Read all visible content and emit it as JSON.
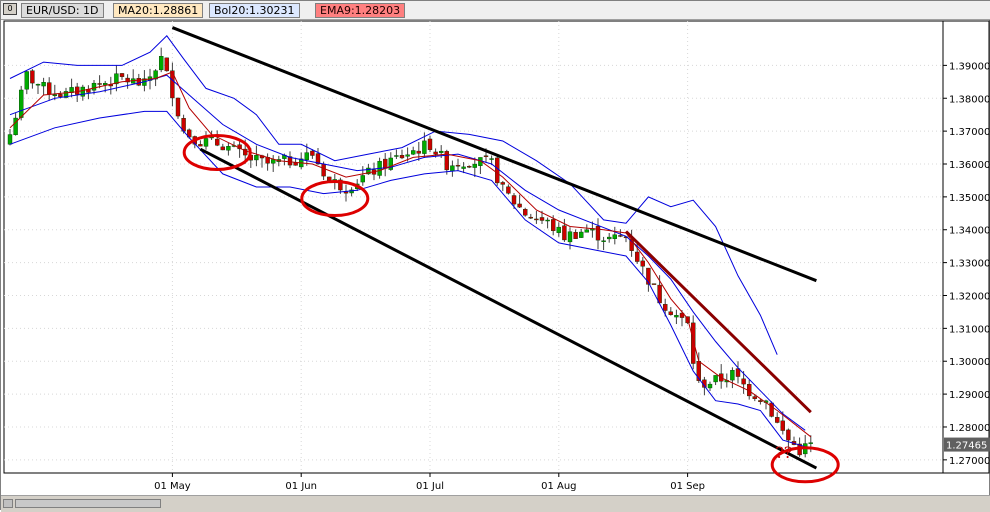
{
  "toolbar": {
    "symbol_tag": "EUR/USD: 1D",
    "ma_tag": "MA20:1.28861",
    "bol_tag": "Bol20:1.30231",
    "ema_tag": "EMA9:1.28203"
  },
  "annotation": {
    "question_marks": "??"
  },
  "colors": {
    "bull": "#00aa00",
    "bear": "#cc0000",
    "wick": "#404040",
    "bollinger": "#0000dd",
    "ma": "#b40000",
    "trendline": "#000000",
    "red_trendline": "#8b0000",
    "circle": "#dd0000",
    "grid": "#d8d8d8"
  },
  "chart_data": {
    "type": "candlestick",
    "title": "",
    "symbol": "EUR/USD",
    "timeframe": "1D",
    "indicators": {
      "MA20": 1.28861,
      "Bol20": 1.30231,
      "EMA9": 1.28203
    },
    "last_price": "1.27465",
    "ylim": [
      1.266,
      1.4035
    ],
    "y_ticks": [
      "1.39000",
      "1.38000",
      "1.37000",
      "1.36000",
      "1.35000",
      "1.34000",
      "1.33000",
      "1.32000",
      "1.31000",
      "1.30000",
      "1.29000",
      "1.28000",
      "1.27000"
    ],
    "x_ticks": [
      {
        "label": "01 May",
        "bar": 29
      },
      {
        "label": "01 Jun",
        "bar": 52
      },
      {
        "label": "01 Jul",
        "bar": 75
      },
      {
        "label": "01 Aug",
        "bar": 98
      },
      {
        "label": "01 Sep",
        "bar": 121
      }
    ],
    "bars": 144,
    "close_points": [
      [
        0,
        1.369
      ],
      [
        3,
        1.387
      ],
      [
        6,
        1.383
      ],
      [
        10,
        1.381
      ],
      [
        15,
        1.384
      ],
      [
        20,
        1.386
      ],
      [
        24,
        1.384
      ],
      [
        27,
        1.392
      ],
      [
        29,
        1.382
      ],
      [
        31,
        1.37
      ],
      [
        34,
        1.367
      ],
      [
        38,
        1.366
      ],
      [
        42,
        1.362
      ],
      [
        46,
        1.36
      ],
      [
        50,
        1.361
      ],
      [
        54,
        1.363
      ],
      [
        57,
        1.355
      ],
      [
        60,
        1.353
      ],
      [
        64,
        1.357
      ],
      [
        68,
        1.361
      ],
      [
        72,
        1.364
      ],
      [
        75,
        1.366
      ],
      [
        78,
        1.36
      ],
      [
        82,
        1.361
      ],
      [
        86,
        1.36
      ],
      [
        88,
        1.352
      ],
      [
        92,
        1.345
      ],
      [
        96,
        1.342
      ],
      [
        99,
        1.338
      ],
      [
        103,
        1.34
      ],
      [
        107,
        1.337
      ],
      [
        110,
        1.338
      ],
      [
        113,
        1.328
      ],
      [
        116,
        1.319
      ],
      [
        119,
        1.314
      ],
      [
        121,
        1.311
      ],
      [
        122,
        1.3
      ],
      [
        123,
        1.293
      ],
      [
        126,
        1.294
      ],
      [
        129,
        1.296
      ],
      [
        132,
        1.291
      ],
      [
        135,
        1.288
      ],
      [
        137,
        1.281
      ],
      [
        139,
        1.276
      ],
      [
        141,
        1.273
      ],
      [
        143,
        1.2746
      ]
    ],
    "bollinger_points": {
      "upper": [
        [
          0,
          1.386
        ],
        [
          6,
          1.391
        ],
        [
          12,
          1.39
        ],
        [
          20,
          1.39
        ],
        [
          25,
          1.394
        ],
        [
          28,
          1.399
        ],
        [
          31,
          1.392
        ],
        [
          35,
          1.383
        ],
        [
          40,
          1.38
        ],
        [
          44,
          1.375
        ],
        [
          48,
          1.366
        ],
        [
          52,
          1.366
        ],
        [
          58,
          1.361
        ],
        [
          64,
          1.363
        ],
        [
          70,
          1.365
        ],
        [
          76,
          1.37
        ],
        [
          82,
          1.369
        ],
        [
          88,
          1.367
        ],
        [
          94,
          1.361
        ],
        [
          100,
          1.354
        ],
        [
          106,
          1.343
        ],
        [
          110,
          1.342
        ],
        [
          114,
          1.35
        ],
        [
          118,
          1.347
        ],
        [
          122,
          1.349
        ],
        [
          126,
          1.341
        ],
        [
          130,
          1.326
        ],
        [
          134,
          1.314
        ],
        [
          137,
          1.302
        ]
      ],
      "middle": [
        [
          0,
          1.375
        ],
        [
          8,
          1.38
        ],
        [
          16,
          1.382
        ],
        [
          24,
          1.385
        ],
        [
          28,
          1.387
        ],
        [
          32,
          1.381
        ],
        [
          38,
          1.372
        ],
        [
          44,
          1.366
        ],
        [
          50,
          1.362
        ],
        [
          56,
          1.36
        ],
        [
          62,
          1.358
        ],
        [
          68,
          1.359
        ],
        [
          74,
          1.362
        ],
        [
          80,
          1.363
        ],
        [
          86,
          1.36
        ],
        [
          92,
          1.352
        ],
        [
          98,
          1.346
        ],
        [
          104,
          1.342
        ],
        [
          110,
          1.338
        ],
        [
          114,
          1.332
        ],
        [
          118,
          1.325
        ],
        [
          122,
          1.315
        ],
        [
          126,
          1.306
        ],
        [
          130,
          1.298
        ],
        [
          134,
          1.291
        ],
        [
          138,
          1.284
        ],
        [
          142,
          1.279
        ]
      ],
      "lower": [
        [
          0,
          1.366
        ],
        [
          8,
          1.371
        ],
        [
          16,
          1.374
        ],
        [
          24,
          1.376
        ],
        [
          28,
          1.376
        ],
        [
          32,
          1.368
        ],
        [
          38,
          1.357
        ],
        [
          44,
          1.353
        ],
        [
          50,
          1.353
        ],
        [
          56,
          1.351
        ],
        [
          62,
          1.352
        ],
        [
          68,
          1.355
        ],
        [
          74,
          1.357
        ],
        [
          80,
          1.358
        ],
        [
          86,
          1.355
        ],
        [
          92,
          1.343
        ],
        [
          98,
          1.336
        ],
        [
          104,
          1.334
        ],
        [
          110,
          1.332
        ],
        [
          114,
          1.324
        ],
        [
          118,
          1.311
        ],
        [
          122,
          1.297
        ],
        [
          126,
          1.288
        ],
        [
          130,
          1.287
        ],
        [
          134,
          1.285
        ],
        [
          138,
          1.276
        ],
        [
          142,
          1.274
        ]
      ]
    },
    "ma_points": [
      [
        0,
        1.371
      ],
      [
        6,
        1.381
      ],
      [
        12,
        1.382
      ],
      [
        20,
        1.385
      ],
      [
        26,
        1.386
      ],
      [
        29,
        1.388
      ],
      [
        32,
        1.377
      ],
      [
        36,
        1.369
      ],
      [
        42,
        1.364
      ],
      [
        48,
        1.361
      ],
      [
        54,
        1.36
      ],
      [
        60,
        1.356
      ],
      [
        66,
        1.358
      ],
      [
        72,
        1.362
      ],
      [
        78,
        1.363
      ],
      [
        84,
        1.361
      ],
      [
        88,
        1.356
      ],
      [
        94,
        1.346
      ],
      [
        100,
        1.341
      ],
      [
        106,
        1.34
      ],
      [
        110,
        1.339
      ],
      [
        114,
        1.33
      ],
      [
        118,
        1.319
      ],
      [
        121,
        1.313
      ],
      [
        123,
        1.3
      ],
      [
        127,
        1.295
      ],
      [
        132,
        1.291
      ],
      [
        137,
        1.285
      ],
      [
        143,
        1.277
      ]
    ],
    "trendlines": [
      {
        "from": [
          29,
          1.4015
        ],
        "to": [
          144,
          1.3245
        ],
        "color": "trendline"
      },
      {
        "from": [
          34,
          1.3645
        ],
        "to": [
          144,
          1.2675
        ],
        "color": "trendline"
      },
      {
        "from": [
          110,
          1.3395
        ],
        "to": [
          143,
          1.2845
        ],
        "color": "red_trendline"
      }
    ],
    "circles": [
      {
        "bar": 37,
        "price": 1.3635
      },
      {
        "bar": 58,
        "price": 1.3495
      },
      {
        "bar": 142,
        "price": 1.2685
      }
    ]
  }
}
